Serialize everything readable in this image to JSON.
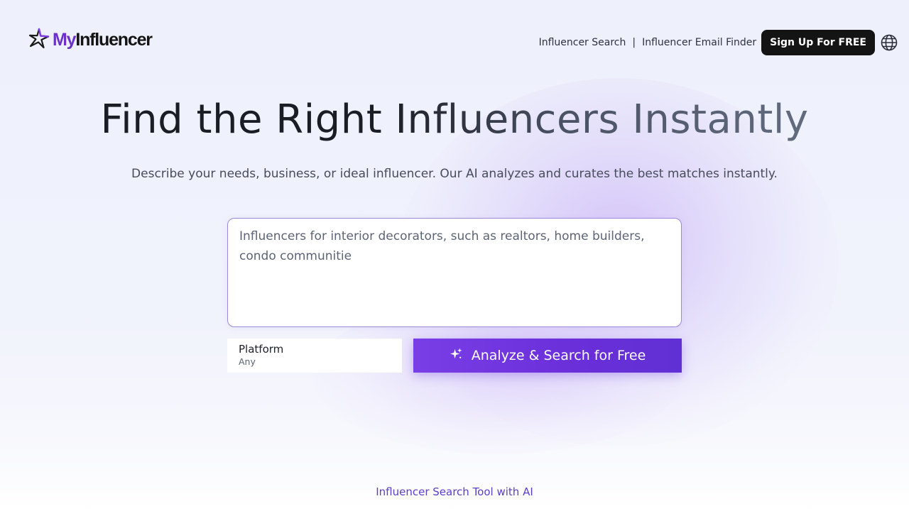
{
  "header": {
    "logo": {
      "part1": "My",
      "part2": "Influencer"
    },
    "nav": {
      "influencer_search": "Influencer Search",
      "separator": "|",
      "email_finder": "Influencer Email Finder",
      "signup": "Sign Up For FREE"
    },
    "icons": {
      "logo": "star-icon",
      "language": "globe-icon"
    }
  },
  "hero": {
    "title": "Find the Right Influencers Instantly",
    "subtitle": "Describe your needs, business, or ideal influencer. Our AI analyzes and curates the best matches instantly."
  },
  "search": {
    "query": "Influencers for interior decorators, such as realtors, home builders, condo communitie"
  },
  "platform": {
    "label": "Platform",
    "value": "Any"
  },
  "analyze_button": {
    "label": "Analyze & Search for Free",
    "icon": "sparkle-icon"
  },
  "footer": {
    "link": "Influencer Search Tool with AI"
  },
  "colors": {
    "accent": "#6a32c8",
    "button": "#6a2fd9",
    "dark": "#141414"
  }
}
